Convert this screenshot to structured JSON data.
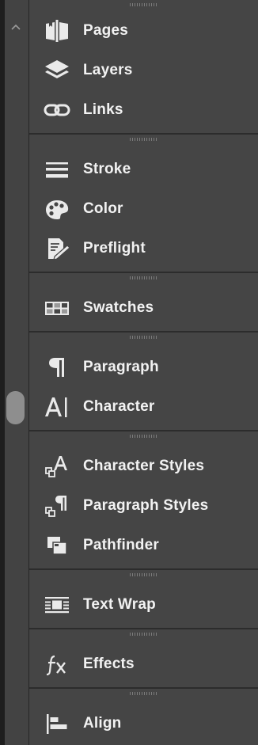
{
  "panels": {
    "items": [
      {
        "label": "Pages",
        "icon": "pages-icon"
      },
      {
        "label": "Layers",
        "icon": "layers-icon"
      },
      {
        "label": "Links",
        "icon": "links-icon"
      },
      {
        "label": "Stroke",
        "icon": "stroke-icon"
      },
      {
        "label": "Color",
        "icon": "color-palette-icon"
      },
      {
        "label": "Preflight",
        "icon": "preflight-icon"
      },
      {
        "label": "Swatches",
        "icon": "swatches-icon"
      },
      {
        "label": "Paragraph",
        "icon": "pilcrow-icon"
      },
      {
        "label": "Character",
        "icon": "character-icon"
      },
      {
        "label": "Character Styles",
        "icon": "character-styles-icon"
      },
      {
        "label": "Paragraph Styles",
        "icon": "paragraph-styles-icon"
      },
      {
        "label": "Pathfinder",
        "icon": "pathfinder-icon"
      },
      {
        "label": "Text Wrap",
        "icon": "text-wrap-icon"
      },
      {
        "label": "Effects",
        "icon": "fx-icon"
      },
      {
        "label": "Align",
        "icon": "align-icon"
      }
    ]
  },
  "colors": {
    "panel_bg": "#454545",
    "scroll_column_bg": "#434343",
    "divider": "#2c2c2c",
    "label_text": "#f2f2f2"
  }
}
